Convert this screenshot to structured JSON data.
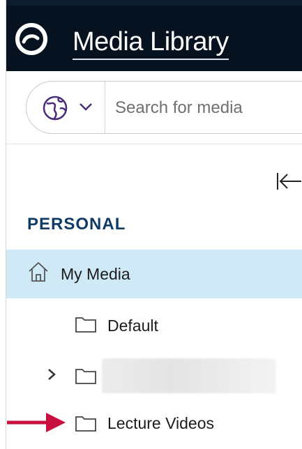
{
  "header": {
    "title": "Media Library",
    "brand_color": "#06121f"
  },
  "search": {
    "placeholder": "Search for media",
    "value": ""
  },
  "sidebar": {
    "section_title": "PERSONAL",
    "items": [
      {
        "label": "My Media",
        "icon": "home-icon",
        "selected": true
      },
      {
        "label": "Default",
        "icon": "folder-icon"
      },
      {
        "label": "",
        "icon": "folder-icon",
        "expandable": true,
        "redacted": true
      },
      {
        "label": "Lecture Videos",
        "icon": "folder-icon"
      }
    ],
    "selected_color": "#cfe9f7"
  },
  "annotation": {
    "arrow_color": "#c8103e"
  }
}
